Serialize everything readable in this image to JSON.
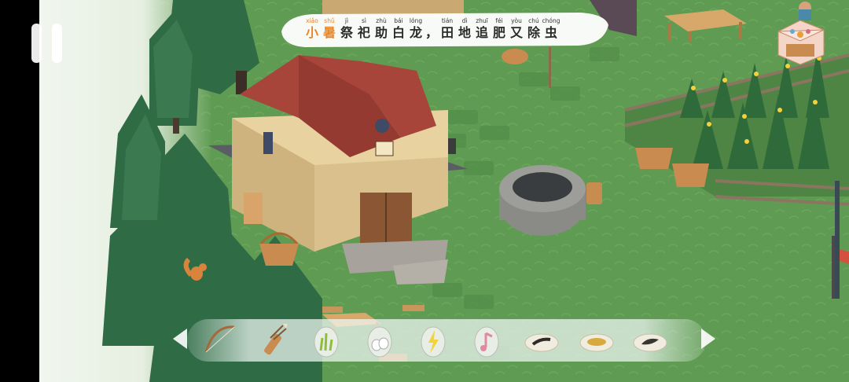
{
  "subtitle": {
    "characters": [
      {
        "hanzi": "小",
        "pinyin": "xiǎo",
        "highlight": true
      },
      {
        "hanzi": "暑",
        "pinyin": "shǔ",
        "highlight": true
      },
      {
        "hanzi": "祭",
        "pinyin": "jì",
        "highlight": false
      },
      {
        "hanzi": "祀",
        "pinyin": "sì",
        "highlight": false
      },
      {
        "hanzi": "助",
        "pinyin": "zhù",
        "highlight": false
      },
      {
        "hanzi": "白",
        "pinyin": "bái",
        "highlight": false
      },
      {
        "hanzi": "龙",
        "pinyin": "lóng",
        "highlight": false
      },
      {
        "hanzi": "，",
        "pinyin": "",
        "highlight": false
      },
      {
        "hanzi": "田",
        "pinyin": "tián",
        "highlight": false
      },
      {
        "hanzi": "地",
        "pinyin": "dì",
        "highlight": false
      },
      {
        "hanzi": "追",
        "pinyin": "zhuī",
        "highlight": false
      },
      {
        "hanzi": "肥",
        "pinyin": "féi",
        "highlight": false
      },
      {
        "hanzi": "又",
        "pinyin": "yòu",
        "highlight": false
      },
      {
        "hanzi": "除",
        "pinyin": "chú",
        "highlight": false
      },
      {
        "hanzi": "虫",
        "pinyin": "chóng",
        "highlight": false
      }
    ],
    "highlight_color": "#e8862a",
    "text_color": "#2b2b2b"
  },
  "inventory": {
    "items": [
      {
        "icon": "bow-icon",
        "name": "bow"
      },
      {
        "icon": "arrow-quiver-icon",
        "name": "quiver"
      },
      {
        "icon": "grass-egg-icon",
        "name": "grass-egg"
      },
      {
        "icon": "white-egg-icon",
        "name": "white-egg"
      },
      {
        "icon": "lightning-egg-icon",
        "name": "lightning-egg"
      },
      {
        "icon": "music-egg-icon",
        "name": "music-egg"
      },
      {
        "icon": "tool-plate-icon",
        "name": "tool-plate"
      },
      {
        "icon": "grain-plate-icon",
        "name": "grain-plate"
      },
      {
        "icon": "feather-plate-icon",
        "name": "feather-plate"
      }
    ]
  },
  "colors": {
    "grass": "#5e9a52",
    "roof": "#a8453a",
    "tree": "#2f6b45",
    "fog": "#eef4ea"
  },
  "icons": {
    "pause": "pause-icon",
    "collection": "treasure-box-icon",
    "prev": "chevron-left-icon",
    "next": "chevron-right-icon"
  }
}
